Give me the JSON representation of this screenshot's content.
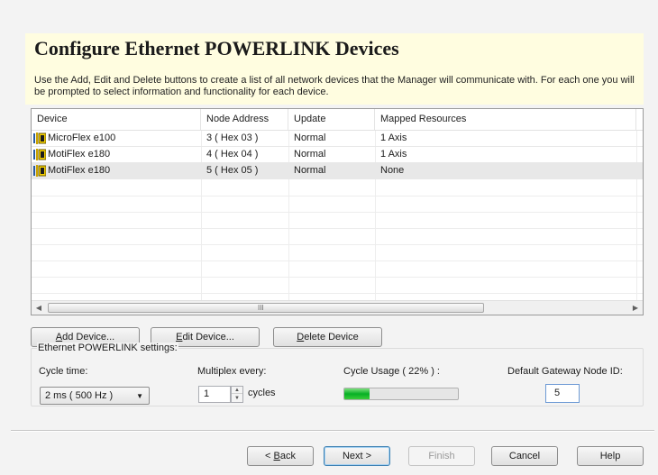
{
  "header": {
    "title": "Configure Ethernet POWERLINK Devices",
    "description": "Use the Add, Edit and Delete buttons to create a list of all network devices that the Manager will communicate with. For each one you will be prompted to select information and functionality for each device."
  },
  "device_list": {
    "columns": [
      "Device",
      "Node Address",
      "Update",
      "Mapped Resources"
    ],
    "rows": [
      {
        "device": "MicroFlex e100",
        "node_address": "3 ( Hex 03 )",
        "update": "Normal",
        "mapped": "1 Axis"
      },
      {
        "device": "MotiFlex e180",
        "node_address": "4 ( Hex 04 )",
        "update": "Normal",
        "mapped": "1 Axis"
      },
      {
        "device": "MotiFlex e180",
        "node_address": "5 ( Hex 05 )",
        "update": "Normal",
        "mapped": "None"
      }
    ],
    "selected_row": 2,
    "device_icon": "network-device-icon",
    "scroll_grip": "III"
  },
  "actions": {
    "add_mnemonic": "A",
    "add_rest": "dd Device...",
    "edit_mnemonic": "E",
    "edit_rest": "dit Device...",
    "delete_mnemonic": "D",
    "delete_rest": "elete Device"
  },
  "settings": {
    "group_title": "Ethernet POWERLINK settings:",
    "cycle_time_label": "Cycle time:",
    "cycle_time_value": "2 ms ( 500 Hz )",
    "multiplex_label": "Multiplex every:",
    "multiplex_value": "1",
    "multiplex_unit": "cycles",
    "cycle_usage_label": "Cycle Usage ( 22% ) :",
    "cycle_usage_percent": 22,
    "gateway_label": "Default Gateway Node ID:",
    "gateway_value": "5"
  },
  "footer": {
    "back_prefix": "< ",
    "back_mnemonic": "B",
    "back_rest": "ack",
    "next_label": "Next >",
    "finish_label": "Finish",
    "cancel_label": "Cancel",
    "help_label": "Help"
  },
  "colors": {
    "header_bg": "#fffde0",
    "progress_green": "#06b025",
    "selected_row": "#e8e8e8"
  }
}
